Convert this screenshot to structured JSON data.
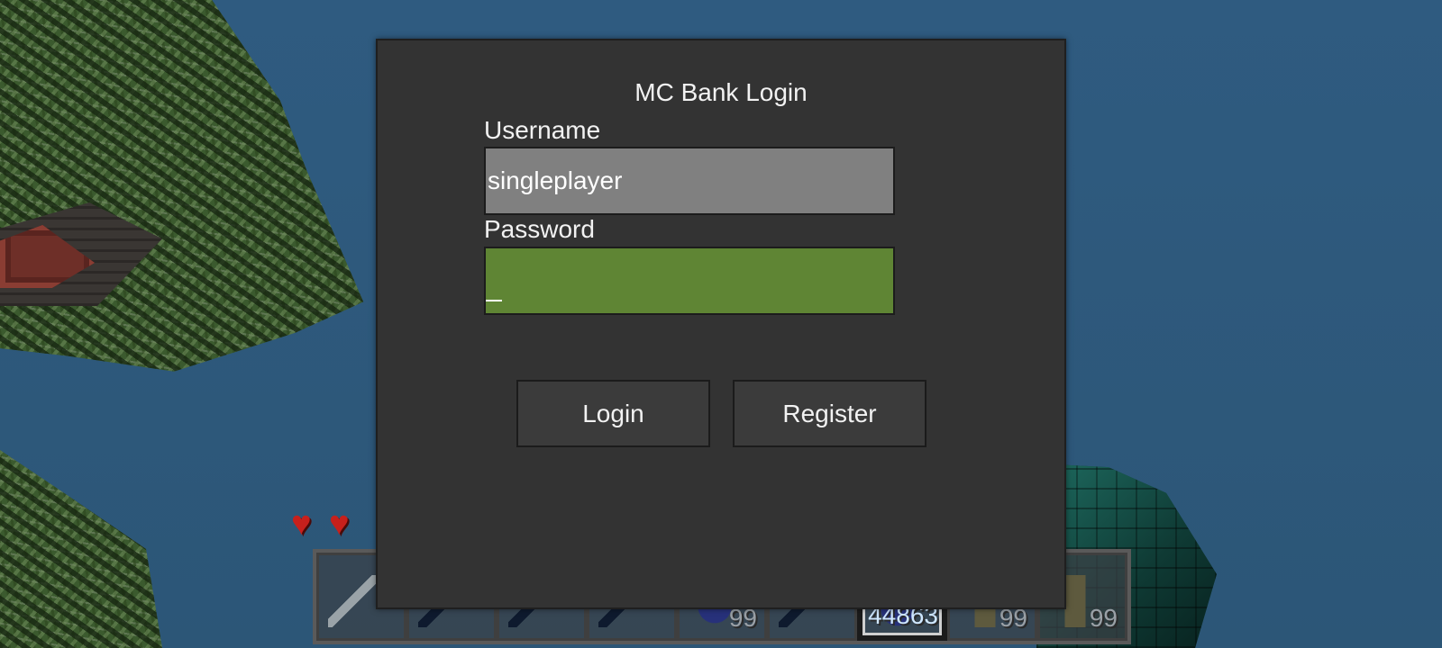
{
  "dialog": {
    "title": "MC Bank Login",
    "username_label": "Username",
    "username_value": "singleplayer",
    "password_label": "Password",
    "password_value": "",
    "login_label": "Login",
    "register_label": "Register"
  },
  "hud": {
    "hearts_visible": 2,
    "hotbar": [
      {
        "item": "iron-sword-icon",
        "count": ""
      },
      {
        "item": "dark-sword-icon",
        "count": ""
      },
      {
        "item": "dark-sword-icon",
        "count": ""
      },
      {
        "item": "dark-tool-icon",
        "count": ""
      },
      {
        "item": "lapis-gem-icon",
        "count": "99"
      },
      {
        "item": "dark-tool-icon",
        "count": ""
      },
      {
        "item": "diamond-icon",
        "count": "44863",
        "selected": true
      },
      {
        "item": "stick-icon",
        "count": "99"
      },
      {
        "item": "book-icon",
        "count": "99"
      }
    ]
  },
  "colors": {
    "dialog_bg": "#333333",
    "username_field_bg": "#808080",
    "password_field_bg": "#5f8534",
    "button_bg": "#3b3b3b",
    "sky": "#2e5a7e"
  }
}
